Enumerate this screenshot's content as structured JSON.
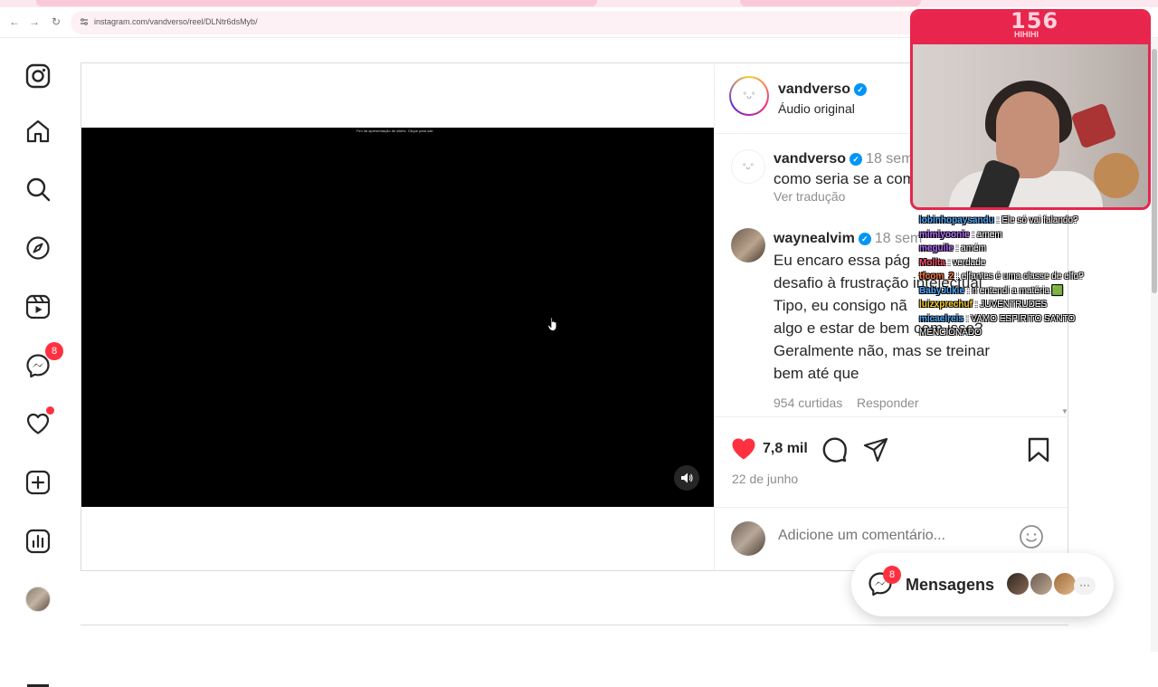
{
  "browser": {
    "url": "instagram.com/vandverso/reel/DLNtr6dsMyb/"
  },
  "sidebar": {
    "messenger_badge": "8"
  },
  "video": {
    "end_message": "Fim da apresentação de slides. Clique para sair."
  },
  "post": {
    "author": "vandverso",
    "audio": "Áudio original",
    "comments": [
      {
        "user": "vandverso",
        "time": "18 sem",
        "text": "como seria se a comi",
        "link": "Ver tradução"
      },
      {
        "user": "waynealvim",
        "time": "18 sem",
        "lines": [
          "Eu encaro essa pág",
          "desafio à frustração intelectual",
          "Tipo, eu consigo nã",
          "algo e estar de bem com isso?",
          "Geralmente não, mas se treinar",
          "bem até que"
        ],
        "likes": "954 curtidas",
        "reply": "Responder"
      }
    ],
    "like_count": "7,8 mil",
    "date": "22 de junho",
    "comment_placeholder": "Adicione um comentário..."
  },
  "messages_bar": {
    "label": "Mensagens",
    "badge": "8",
    "more": "···"
  },
  "stream": {
    "viewer_count": "156",
    "viewer_label": "HIHIHI",
    "chat": [
      {
        "user": "lobinhopaysandu",
        "msg": ": Ele só vai falando?",
        "color": "#4aa8ff"
      },
      {
        "user": "mimiyoonie",
        "msg": ": amem",
        "color": "#b36bff"
      },
      {
        "user": "meguile",
        "msg": ": amém",
        "color": "#b36bff"
      },
      {
        "user": "Molita",
        "msg": ": verdade",
        "color": "#ff4d6d"
      },
      {
        "user": "tfcom_2",
        "msg": ": elfantes é uma classe de elfo?",
        "color": "#ff7a45"
      },
      {
        "user": "BabyJukie",
        "msg": ": n entendi a matéria 🟩",
        "color": "#4aa8ff"
      },
      {
        "user": "luizxprechuf",
        "msg": ": JUVENTRUDES",
        "color": "#ffd21f"
      },
      {
        "user": "micaelreis",
        "msg": ": VAMO ESPIRITO SANTO",
        "color": "#4aa8ff"
      },
      {
        "user": "",
        "msg": "MENCIONADO",
        "color": "#ffffff"
      }
    ]
  },
  "colors": {
    "like": "#ff3040",
    "verified": "#0095f6",
    "stream_accent": "#e8254d"
  }
}
